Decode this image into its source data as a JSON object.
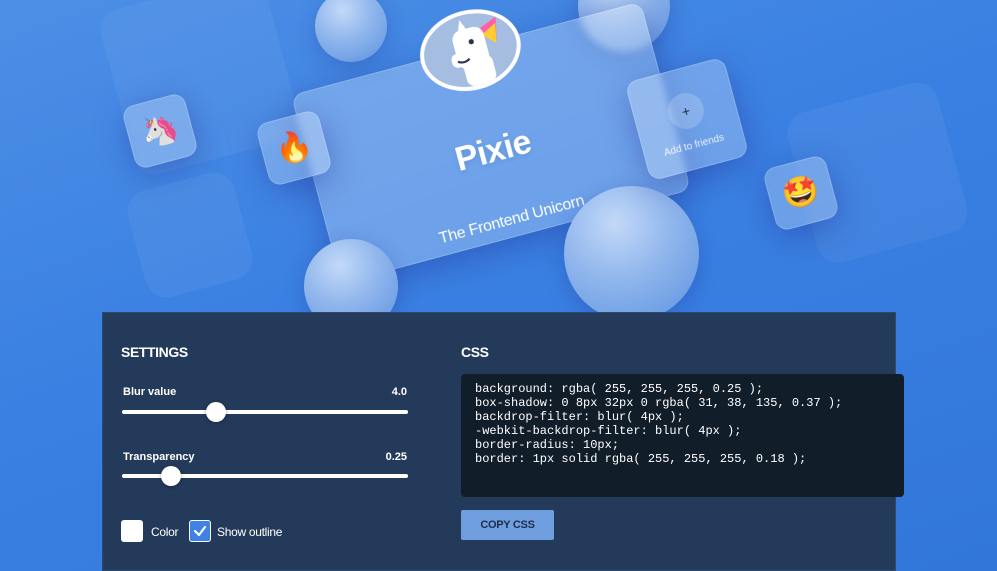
{
  "card": {
    "name": "Pixie",
    "tagline": "The Frontend Unicorn",
    "add_friends_label": "Add to friends",
    "add_icon": "+"
  },
  "emojis": {
    "unicorn": "🦄",
    "fire": "🔥",
    "star_struck": "🤩"
  },
  "settings": {
    "title": "SETTINGS",
    "blur": {
      "label": "Blur value",
      "value": "4.0",
      "fraction": 0.33
    },
    "transparency": {
      "label": "Transparency",
      "value": "0.25",
      "fraction": 0.17
    },
    "color_label": "Color",
    "outline_label": "Show outline",
    "color_checked": false,
    "outline_checked": true
  },
  "css_panel": {
    "title": "CSS",
    "lines": [
      "background: rgba( 255, 255, 255, 0.25 );",
      "box-shadow: 0 8px 32px 0 rgba( 31, 38, 135, 0.37 );",
      "backdrop-filter: blur( 4px );",
      "-webkit-backdrop-filter: blur( 4px );",
      "border-radius: 10px;",
      "border: 1px solid rgba( 255, 255, 255, 0.18 );"
    ],
    "copy_label": "COPY CSS"
  },
  "colors": {
    "background": "#3a80e2",
    "panel": "#243a5a",
    "code_bg": "#121d2a",
    "checkbox_checked": "#3f82e4",
    "button": "#6f9fdf"
  }
}
